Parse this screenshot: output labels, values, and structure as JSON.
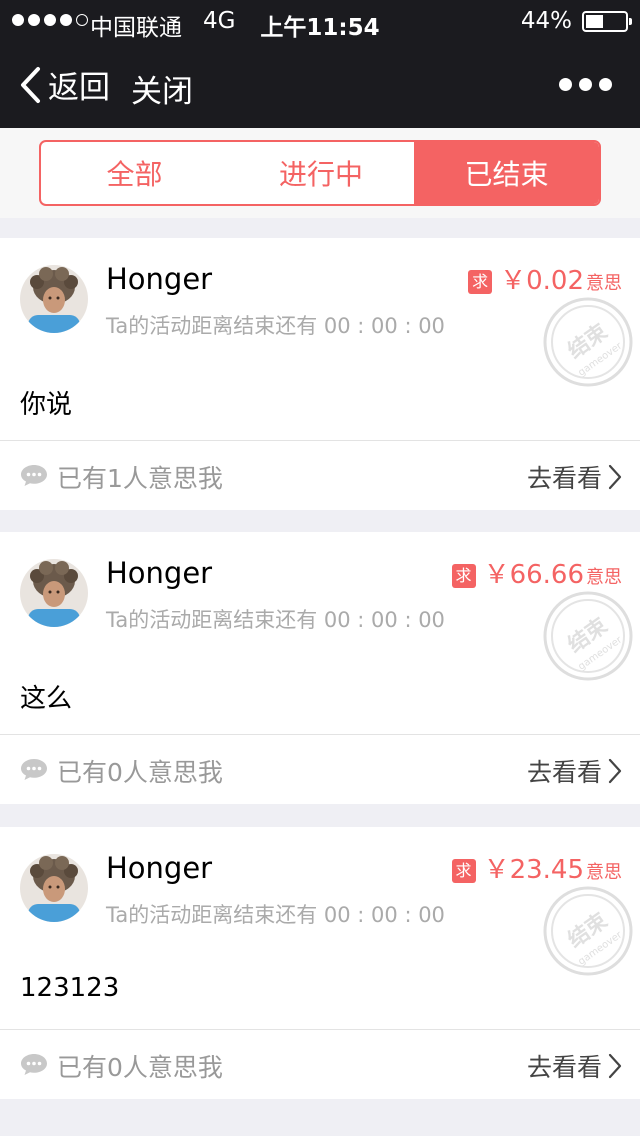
{
  "status_bar": {
    "signal_dots_filled": 4,
    "signal_dots_total": 5,
    "carrier": "中国联通",
    "network": "4G",
    "time": "上午11:54",
    "battery_percent_text": "44%",
    "battery_level": 0.44
  },
  "nav": {
    "back_label": "返回",
    "close_label": "关闭",
    "more_icon": "more-dots-icon"
  },
  "tabs": [
    {
      "label": "全部",
      "active": false
    },
    {
      "label": "进行中",
      "active": false
    },
    {
      "label": "已结束",
      "active": true
    }
  ],
  "items": [
    {
      "user": "Honger",
      "subtitle": "Ta的活动距离结束还有 00 : 00 : 00",
      "badge": "求",
      "amount": "￥0.02",
      "unit": "意思",
      "content": "你说",
      "count_text": "已有1人意思我",
      "action": "去看看",
      "stamp_main": "结束",
      "stamp_sub": "gameover"
    },
    {
      "user": "Honger",
      "subtitle": "Ta的活动距离结束还有 00 : 00 : 00",
      "badge": "求",
      "amount": "￥66.66",
      "unit": "意思",
      "content": "这么",
      "count_text": "已有0人意思我",
      "action": "去看看",
      "stamp_main": "结束",
      "stamp_sub": "gameover"
    },
    {
      "user": "Honger",
      "subtitle": "Ta的活动距离结束还有 00 : 00 : 00",
      "badge": "求",
      "amount": "￥23.45",
      "unit": "意思",
      "content": "123123",
      "count_text": "已有0人意思我",
      "action": "去看看",
      "stamp_main": "结束",
      "stamp_sub": "gameover"
    }
  ],
  "colors": {
    "accent": "#f46363",
    "nav_bg": "#1b1b1f",
    "page_bg": "#efeff4"
  }
}
